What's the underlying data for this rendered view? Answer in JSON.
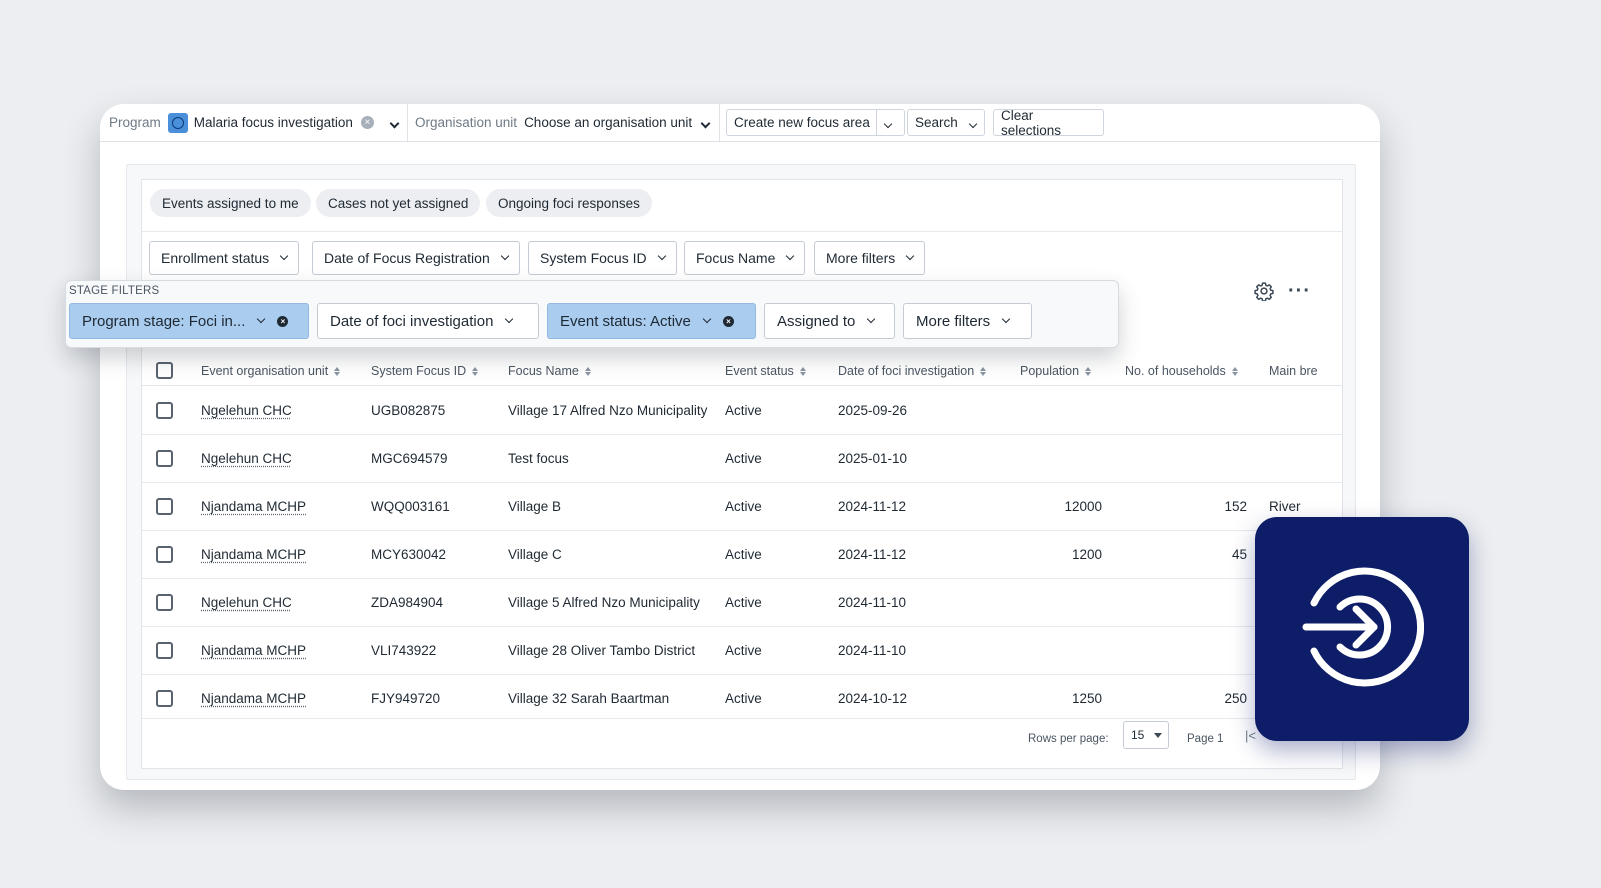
{
  "topbar": {
    "program_label": "Program",
    "program_value": "Malaria focus investigation",
    "orgunit_label": "Organisation unit",
    "orgunit_value": "Choose an organisation unit",
    "create_label": "Create new focus area",
    "search_label": "Search",
    "clear_label": "Clear selections"
  },
  "quick_filters": [
    "Events assigned to me",
    "Cases not yet assigned",
    "Ongoing foci responses"
  ],
  "filters": [
    "Enrollment status",
    "Date of Focus Registration",
    "System Focus ID",
    "Focus Name",
    "More filters"
  ],
  "stage_filters": {
    "title": "STAGE FILTERS",
    "items": [
      "Program stage: Foci in...",
      "Date of foci investigation",
      "Event status: Active",
      "Assigned to",
      "More filters"
    ]
  },
  "table": {
    "columns": [
      "Event organisation unit",
      "System Focus ID",
      "Focus Name",
      "Event status",
      "Date of foci investigation",
      "Population",
      "No. of households",
      "Main bre"
    ],
    "rows": [
      [
        "Ngelehun CHC",
        "UGB082875",
        "Village 17 Alfred Nzo Municipality",
        "Active",
        "2025-09-26",
        "",
        "",
        ""
      ],
      [
        "Ngelehun CHC",
        "MGC694579",
        "Test focus",
        "Active",
        "2025-01-10",
        "",
        "",
        ""
      ],
      [
        "Njandama MCHP",
        "WQQ003161",
        "Village B",
        "Active",
        "2024-11-12",
        "12000",
        "152",
        "River"
      ],
      [
        "Njandama MCHP",
        "MCY630042",
        "Village C",
        "Active",
        "2024-11-12",
        "1200",
        "45",
        ""
      ],
      [
        "Ngelehun CHC",
        "ZDA984904",
        "Village 5 Alfred Nzo Municipality",
        "Active",
        "2024-11-10",
        "",
        "",
        ""
      ],
      [
        "Njandama MCHP",
        "VLI743922",
        "Village 28 Oliver Tambo District",
        "Active",
        "2024-11-10",
        "",
        "",
        ""
      ],
      [
        "Njandama MCHP",
        "FJY949720",
        "Village 32 Sarah Baartman",
        "Active",
        "2024-10-12",
        "1250",
        "250",
        ""
      ]
    ]
  },
  "pagination": {
    "rows_per_page_label": "Rows per page:",
    "rows_per_page_value": "15",
    "page_label": "Page 1"
  },
  "icons": {
    "program": "circle-icon",
    "settings": "gear-icon",
    "more": "more-dots-icon",
    "app_badge": "login-arrow-icon"
  },
  "colors": {
    "active_filter": "#a9ccef",
    "badge_bg": "#0d1d67",
    "program_icon": "#4a8fd9"
  }
}
